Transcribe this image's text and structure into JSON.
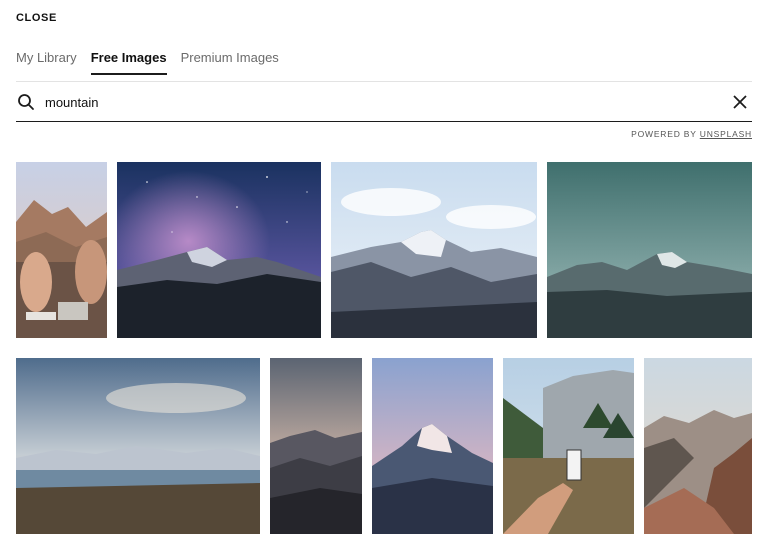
{
  "header": {
    "close_label": "CLOSE"
  },
  "tabs": [
    {
      "label": "My Library"
    },
    {
      "label": "Free Images"
    },
    {
      "label": "Premium Images"
    }
  ],
  "search": {
    "value": "mountain",
    "placeholder": ""
  },
  "powered_by": {
    "prefix": "POWERED BY",
    "brand": "UNSPLASH"
  },
  "images": [
    {
      "subject": "friends sitting with canyon view"
    },
    {
      "subject": "milky way night sky over mountain"
    },
    {
      "subject": "snowy peaks under cloudy sky"
    },
    {
      "subject": "teal sky over mountain ridge"
    },
    {
      "subject": "lake with snowy range at dusk"
    },
    {
      "subject": "misty dark mountains"
    },
    {
      "subject": "snowcapped peak at sunrise"
    },
    {
      "subject": "hand holding phone in valley"
    },
    {
      "subject": "rocky mountain slopes in haze"
    }
  ]
}
